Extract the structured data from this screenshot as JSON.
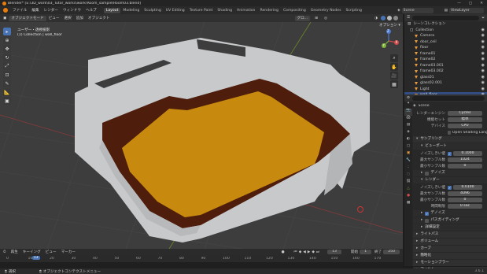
{
  "title_bar": {
    "text": "Blender* [E:\\3D_work\\03_Tutor_works\\work\\Room_sample\\Room03.blend]"
  },
  "menus": [
    "ファイル",
    "編集",
    "レンダー",
    "ウィンドウ",
    "ヘルプ"
  ],
  "workspaces": [
    "Layout",
    "Modeling",
    "Sculpting",
    "UV Editing",
    "Texture Paint",
    "Shading",
    "Animation",
    "Rendering",
    "Compositing",
    "Geometry Nodes",
    "Scripting"
  ],
  "scene_name": "Scene",
  "view_layer": "ViewLayer",
  "viewport_header": {
    "mode": "オブジェクトモード",
    "items": [
      "ビュー",
      "選択",
      "追加",
      "オブジェクト"
    ],
    "transform": "グロ..."
  },
  "viewport": {
    "info_line1": "ユーザー・透視投影",
    "info_line2": "(1) Collection | wall_floor",
    "options_label": "オプション ▾",
    "gizmo_axes": [
      "Z",
      "X",
      "Y"
    ]
  },
  "outliner": {
    "search_placeholder": "",
    "root": "シーンコレクション",
    "collection": "Collection",
    "items": [
      "Camera",
      "door_ceil",
      "floor",
      "frame01",
      "frame02",
      "frame03.001",
      "frame03.002",
      "glass01",
      "glass02.001",
      "Light",
      "wall_floor"
    ],
    "selected": "wall_floor"
  },
  "properties": {
    "scene": "Scene",
    "render_engine_label": "レンダーエンジン",
    "render_engine": "Cycles",
    "feature_set_label": "機能セット",
    "feature_set": "標準",
    "device_label": "デバイス",
    "device": "CPU",
    "osl_label": "Open Shading Language",
    "sampling": "サンプリング",
    "viewport_sec": "ビューポート",
    "noise_threshold_label": "ノイズしきい値",
    "noise_threshold_vp": "0.1000",
    "max_samples_label": "最大サンプル数",
    "max_samples_vp": "1024",
    "min_samples_label": "最小サンプル数",
    "min_samples_vp": "0",
    "denoise_label": "デノイズ",
    "render_sec": "レンダー",
    "noise_threshold_r": "0.0100",
    "max_samples_r": "4096",
    "min_samples_r": "0",
    "time_limit_label": "時間制限",
    "time_limit": "0 sec",
    "denoise2_label": "デノイズ",
    "path_guiding": "パスガイディング",
    "advanced": "詳細設定",
    "sections": [
      "ライトパス",
      "ボリューム",
      "カーブ",
      "簡略化",
      "モーションブラー",
      "フィルム"
    ]
  },
  "timeline": {
    "menus": [
      "再生",
      "キーイング",
      "ビュー",
      "マーカー"
    ],
    "current_frame": "13",
    "start_label": "開始",
    "start": "1",
    "end_label": "終了",
    "end": "250",
    "ticks": [
      "0",
      "10",
      "20",
      "30",
      "40",
      "50",
      "60",
      "70",
      "80",
      "90",
      "100",
      "110",
      "120",
      "130",
      "140",
      "150",
      "160",
      "170"
    ],
    "playhead_label": "13"
  },
  "status_bar": {
    "left": "選択",
    "middle": "オブジェクトコンテクストメニュー",
    "version": "3.6.1"
  },
  "colors": {
    "accent": "#4772b3",
    "floor": "#c88a0e",
    "wall_inner": "#4e1d0c",
    "wall": "#c9c9c9"
  }
}
